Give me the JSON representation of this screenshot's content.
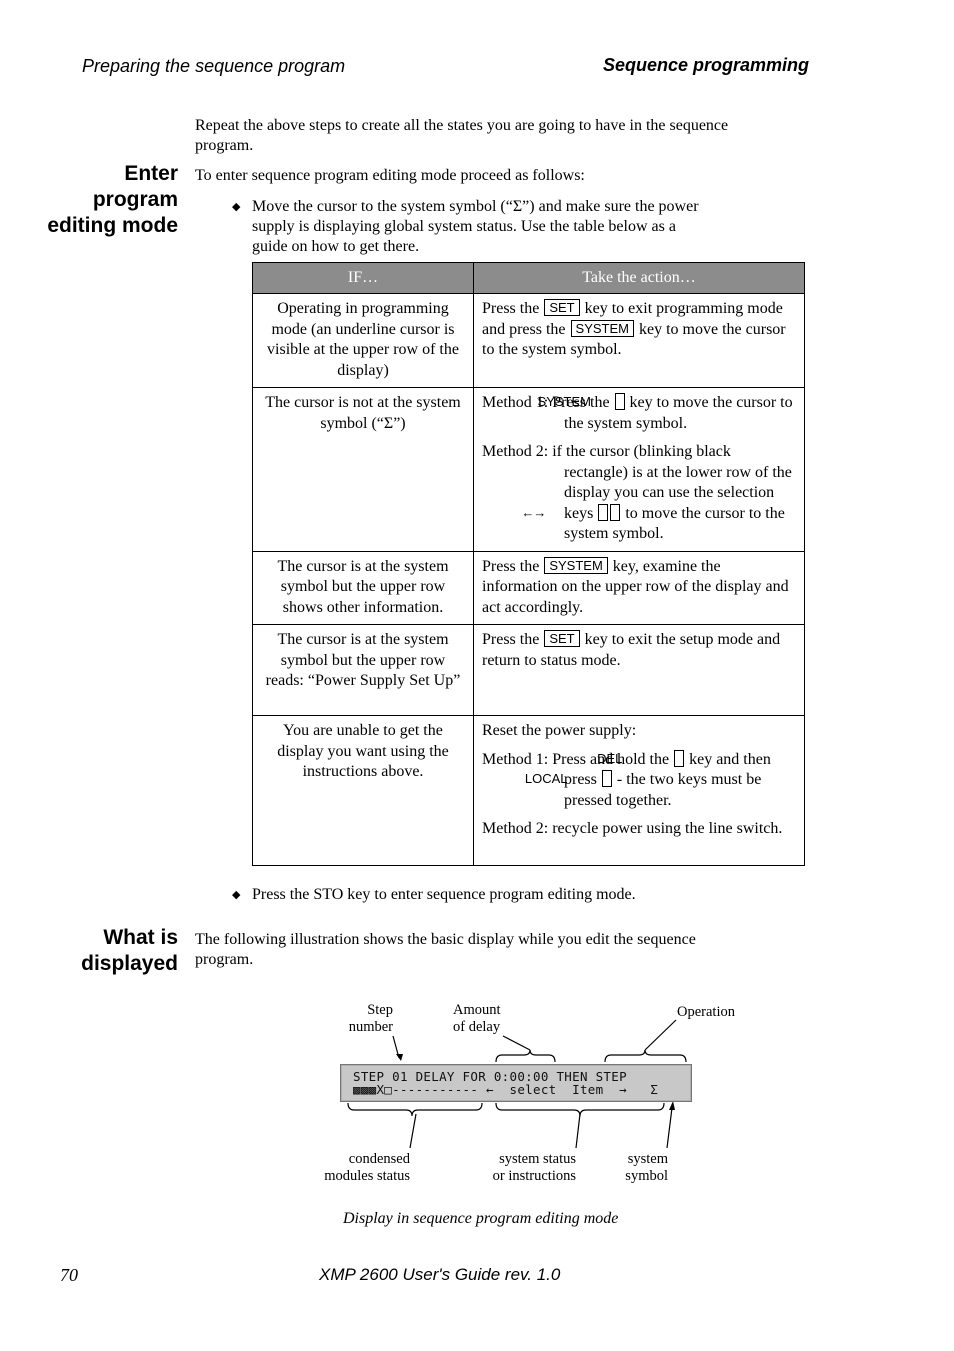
{
  "header": {
    "left": "Preparing the sequence program",
    "right": "Sequence programming"
  },
  "intro": {
    "line1": "Repeat the above steps to create all the states you are going to have in the sequence",
    "line2": "program."
  },
  "section1": {
    "heading": [
      "Enter",
      "program",
      "editing mode"
    ],
    "lead": "To enter sequence program editing mode proceed as follows:",
    "bullet1": [
      "Move the cursor to the system symbol (“Σ”) and make sure the power",
      "supply is displaying global system status. Use the table below as a",
      "guide on how to get there."
    ],
    "bullet2": "Press the STO key to enter sequence program editing mode."
  },
  "table": {
    "headers": [
      "IF…",
      "Take the action…"
    ],
    "rows": [
      {
        "condition": "Operating in programming mode (an underline cursor is visible at the upper row of the display)",
        "action": {
          "a": "Press the ",
          "k1": "SET",
          "b": " key to exit programming mode and press the ",
          "k2": "SYSTEM",
          "c": " key to move the cursor to the system symbol."
        }
      },
      {
        "condition": "The cursor is not at the system symbol (“Σ”)",
        "action": {
          "m1a": "Method 1: Press the ",
          "m1k": "SYSTEM",
          "m1b": " key to move the cursor to the system symbol.",
          "m2a": "Method 2: if the cursor (blinking black rectangle) is at the lower row of the display you can use the selection keys ",
          "m2k1": "←",
          "m2k2": "→",
          "m2b": " to move the cursor to the system symbol."
        }
      },
      {
        "condition": "The cursor is at the system symbol but the upper row shows other information.",
        "action": {
          "a": "Press the ",
          "k1": "SYSTEM",
          "b": " key, examine the information on the upper row of the display and act accordingly."
        }
      },
      {
        "condition": "The cursor is at the system symbol but the upper row reads: “Power Supply Set Up”",
        "action": {
          "a": "Press the ",
          "k1": "SET",
          "b": " key to exit the setup mode and return to status mode."
        }
      },
      {
        "condition": "You are unable to get the display you want using the instructions above.",
        "action": {
          "intro": "Reset the power supply:",
          "m1a": "Method 1: Press and hold the ",
          "m1k1": "DEL",
          "m1b": " key and then press ",
          "m1k2": "LOCAL",
          "m1c": " - the two keys must be pressed together.",
          "m2": "Method 2: recycle power using the line switch."
        }
      }
    ]
  },
  "section2": {
    "heading": [
      "What is",
      "displayed"
    ],
    "text_line1": "The following illustration shows the basic display while you edit the sequence",
    "text_line2": "program."
  },
  "figure": {
    "lcd_line1": "STEP 01 DELAY FOR 0:00:00 THEN STEP",
    "lcd_line2": "▩▩▩X□----------- ←  select  Item  →   Σ",
    "labels": {
      "step_number": [
        "Step",
        "number"
      ],
      "amount_of_delay": [
        "Amount",
        "of delay"
      ],
      "operation": "Operation",
      "condensed_modules_status": [
        "condensed",
        "modules status"
      ],
      "system_status": [
        "system status",
        "or instructions"
      ],
      "system_symbol": [
        "system",
        "symbol"
      ]
    },
    "caption": "Display in sequence program editing mode"
  },
  "footer": {
    "page_number": "70",
    "title": "XMP 2600 User's Guide rev. 1.0"
  }
}
